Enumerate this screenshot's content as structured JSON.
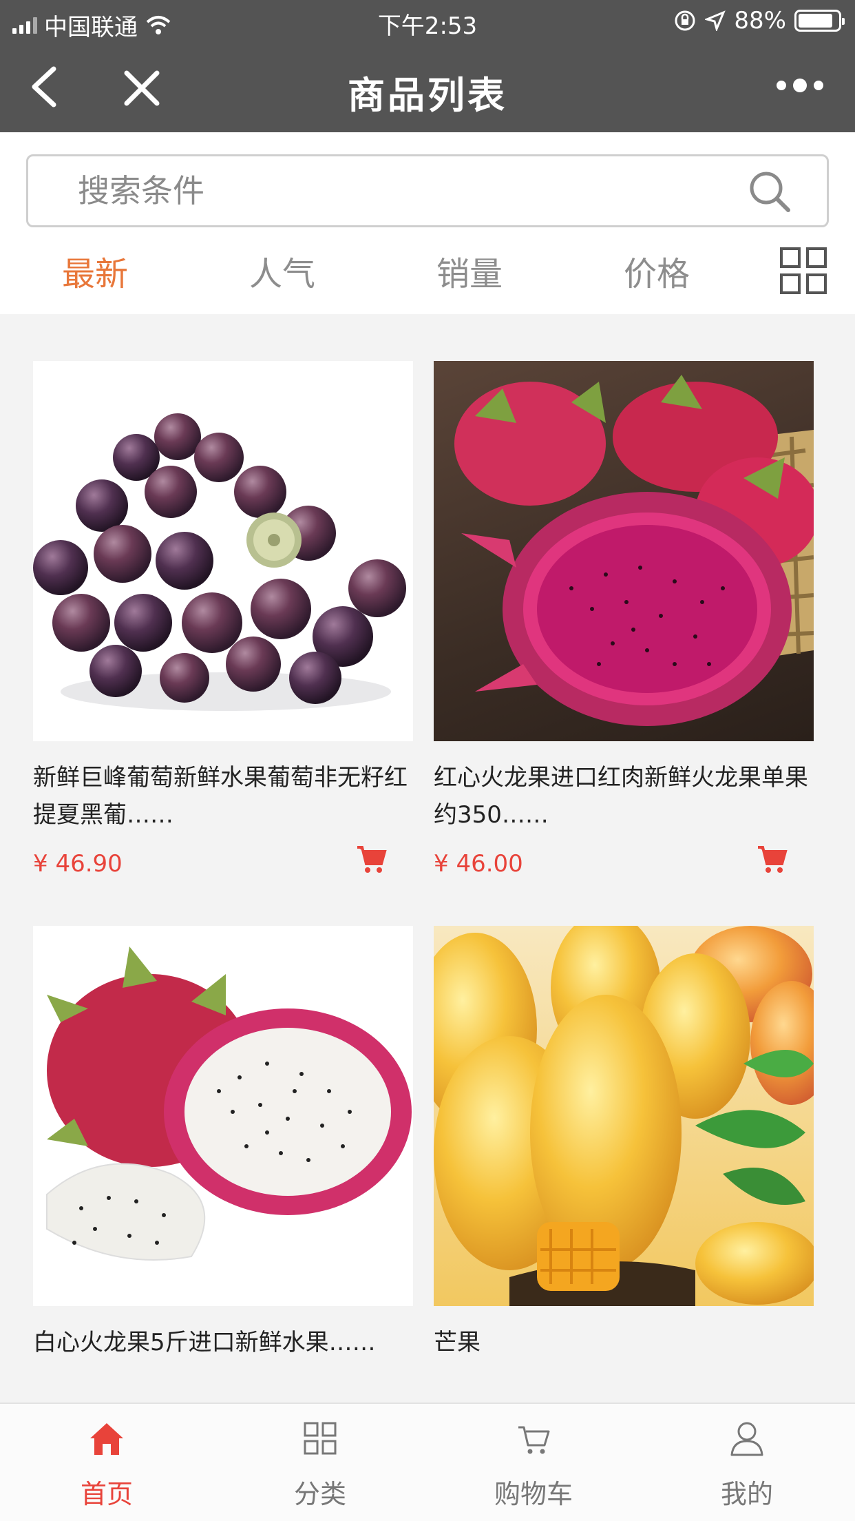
{
  "status_bar": {
    "carrier": "中国联通",
    "time": "下午2:53",
    "battery": "88%",
    "battery_level": 0.88
  },
  "header": {
    "title": "商品列表",
    "back_icon": "chevron-left-icon",
    "close_icon": "close-icon",
    "more_icon": "more-dots-icon"
  },
  "search": {
    "placeholder": "搜索条件",
    "value": ""
  },
  "sort_tabs": [
    {
      "label": "最新",
      "active": true
    },
    {
      "label": "人气",
      "active": false
    },
    {
      "label": "销量",
      "active": false
    },
    {
      "label": "价格",
      "active": false
    }
  ],
  "products": [
    {
      "name": "新鲜巨峰葡萄新鲜水果葡萄非无籽红提夏黑葡……",
      "price": "¥ 46.90",
      "image": "grapes"
    },
    {
      "name": "红心火龙果进口红肉新鲜火龙果单果约350……",
      "price": "¥ 46.00",
      "image": "red-dragon-fruit"
    },
    {
      "name": "白心火龙果5斤进口新鲜水果……",
      "price": "",
      "image": "white-dragon-fruit"
    },
    {
      "name": "芒果",
      "price": "",
      "image": "mango"
    }
  ],
  "tab_bar": [
    {
      "label": "首页",
      "icon": "home-icon",
      "active": true
    },
    {
      "label": "分类",
      "icon": "category-grid-icon",
      "active": false
    },
    {
      "label": "购物车",
      "icon": "cart-icon",
      "active": false
    },
    {
      "label": "我的",
      "icon": "user-icon",
      "active": false
    }
  ],
  "colors": {
    "header_bg": "#545454",
    "accent_orange": "#e8773a",
    "price_red": "#e8433a"
  }
}
